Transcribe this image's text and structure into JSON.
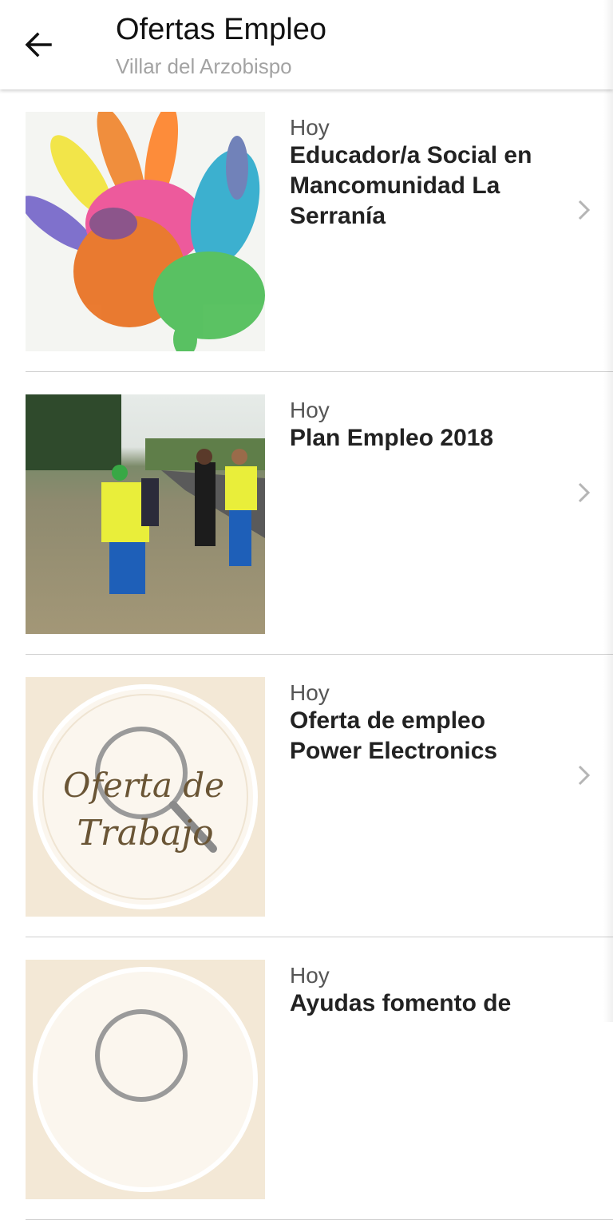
{
  "header": {
    "title": "Ofertas Empleo",
    "subtitle": "Villar del Arzobispo"
  },
  "items": [
    {
      "date": "Hoy",
      "title": "Educador/a Social en Mancomunidad La Serranía",
      "image": "colorful-hands-image"
    },
    {
      "date": "Hoy",
      "title": "Plan Empleo 2018",
      "image": "workers-photo"
    },
    {
      "date": "Hoy",
      "title": "Oferta de empleo Power Electronics",
      "image": "oferta-de-trabajo-logo",
      "image_text": "Oferta de Trabajo"
    },
    {
      "date": "Hoy",
      "title": "Ayudas fomento de",
      "image": "beige-logo-image"
    }
  ],
  "colors": {
    "text_primary": "#222222",
    "text_secondary": "#a3a3a3",
    "divider": "#cfcfcf",
    "chevron": "#b5b5b5"
  }
}
